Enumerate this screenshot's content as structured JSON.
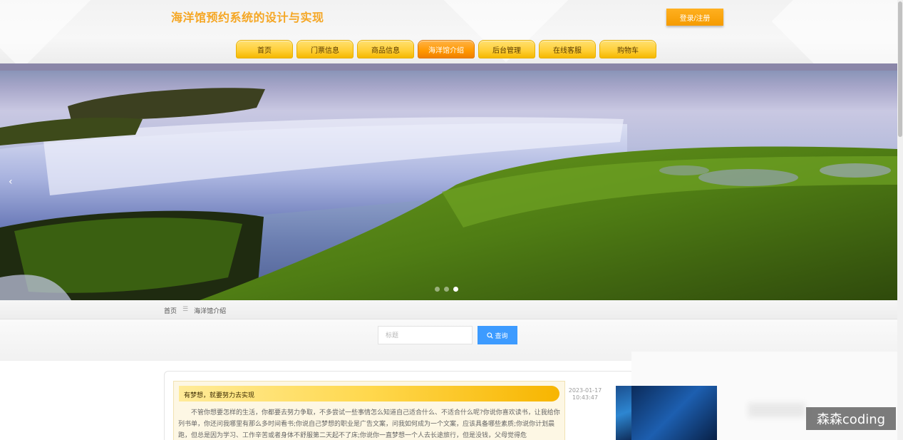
{
  "header": {
    "site_title": "海洋馆预约系统的设计与实现",
    "login_label": "登录/注册"
  },
  "nav": {
    "items": [
      {
        "label": "首页",
        "active": false
      },
      {
        "label": "门票信息",
        "active": false
      },
      {
        "label": "商品信息",
        "active": false
      },
      {
        "label": "海洋馆介绍",
        "active": true
      },
      {
        "label": "后台管理",
        "active": false
      },
      {
        "label": "在线客服",
        "active": false
      },
      {
        "label": "购物车",
        "active": false
      }
    ]
  },
  "banner": {
    "prev_icon": "chevron-left-icon",
    "slide_count": 3,
    "active_slide": 3
  },
  "breadcrumb": {
    "home": "首页",
    "separator": "☰",
    "current": "海洋馆介绍"
  },
  "search": {
    "placeholder": "标题",
    "button_label": "查询",
    "button_icon": "search-icon"
  },
  "articles": [
    {
      "title": "有梦想，就要努力去实现",
      "date": "2023-01-17",
      "time": "10:43:47",
      "excerpt": "不管你想要怎样的生活，你都要去努力争取，不多尝试一些事情怎么知道自己适合什么、不适合什么呢?你说你喜欢读书，让我给你列书单，你还问我哪里有那么多时间看书;你说自己梦想的职业是广告文案，问我如何成为一个文案，应该具备哪些素质;你说你计划晨跑，但总是因为学习、工作辛苦或者身体不舒服第二天起不了床;你说你一直梦想一个人去长途旅行，但是没钱，父母觉得危"
    }
  ],
  "watermark": "森森coding",
  "colors": {
    "accent": "#f5a623",
    "nav_gold": "#ffd03a",
    "nav_active": "#ff9800",
    "search_button": "#3d9bff"
  }
}
